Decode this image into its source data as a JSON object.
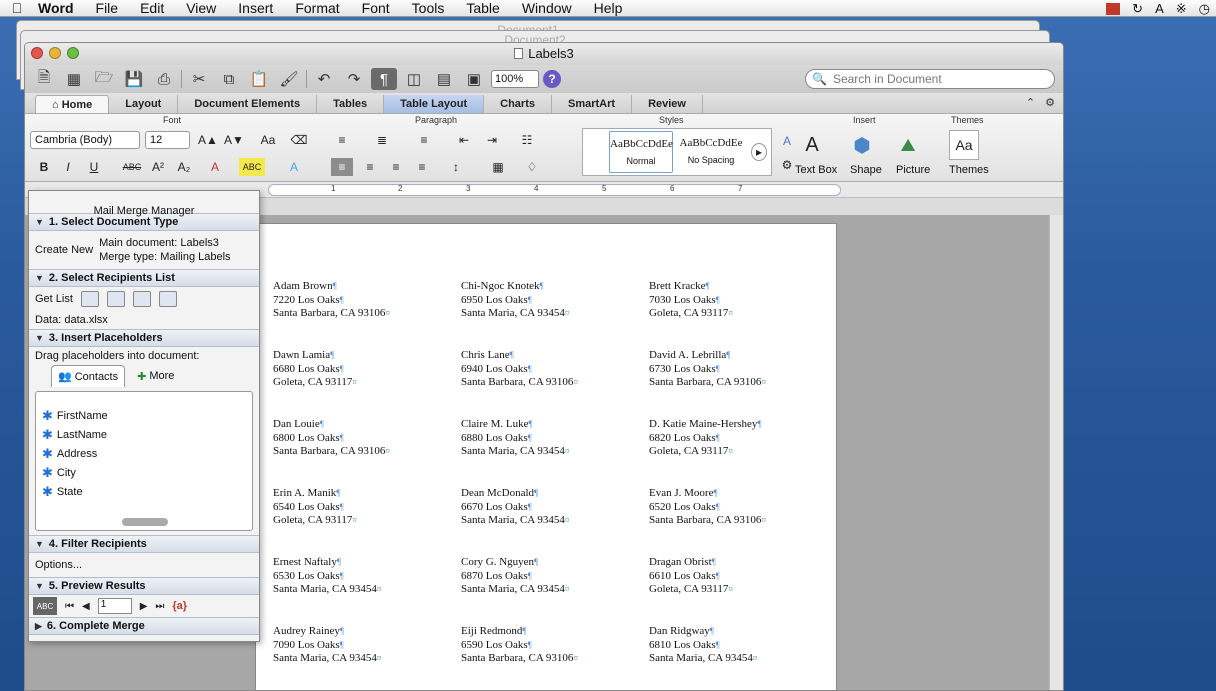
{
  "menubar": {
    "app": "Word",
    "items": [
      "File",
      "Edit",
      "View",
      "Insert",
      "Format",
      "Font",
      "Tools",
      "Table",
      "Window",
      "Help"
    ]
  },
  "bg_windows": [
    "Document1",
    "Document2"
  ],
  "window": {
    "title": "Labels3"
  },
  "toolbar": {
    "zoom": "100%",
    "search_placeholder": "Search in Document"
  },
  "ribbon": {
    "tabs": [
      "Home",
      "Layout",
      "Document Elements",
      "Tables",
      "Table Layout",
      "Charts",
      "SmartArt",
      "Review"
    ],
    "groups": {
      "font": "Font",
      "paragraph": "Paragraph",
      "styles": "Styles",
      "insert": "Insert",
      "themes": "Themes"
    },
    "font_name": "Cambria (Body)",
    "font_size": "12",
    "styles": [
      {
        "sample": "AaBbCcDdEe",
        "name": "Normal"
      },
      {
        "sample": "AaBbCcDdEe",
        "name": "No Spacing"
      }
    ],
    "insert_buttons": [
      "Text Box",
      "Shape",
      "Picture"
    ],
    "themes_button": "Themes"
  },
  "ruler": [
    "1",
    "2",
    "3",
    "4",
    "5",
    "6",
    "7"
  ],
  "mail_merge": {
    "title": "Mail Merge Manager",
    "sec1": "1. Select Document Type",
    "create_new": "Create New",
    "main_document": "Main document: Labels3",
    "merge_type": "Merge type: Mailing Labels",
    "sec2": "2. Select Recipients List",
    "get_list": "Get List",
    "data_source": "Data: data.xlsx",
    "sec3": "3. Insert Placeholders",
    "drag_hint": "Drag placeholders into document:",
    "tab_contacts": "Contacts",
    "tab_more": "More",
    "placeholders": [
      "FirstName",
      "LastName",
      "Address",
      "City",
      "State"
    ],
    "sec4": "4. Filter Recipients",
    "options": "Options...",
    "sec5": "5. Preview Results",
    "record": "1",
    "field_codes": "{a}",
    "sec6": "6. Complete Merge"
  },
  "labels": [
    [
      "Adam Brown",
      "7220 Los Oaks",
      "Santa Barbara, CA 93106"
    ],
    [
      "Chi-Ngoc Knotek",
      "6950 Los Oaks",
      "Santa Maria, CA 93454"
    ],
    [
      "Brett Kracke",
      "7030 Los Oaks",
      "Goleta, CA 93117"
    ],
    [
      "Dawn Lamia",
      "6680 Los Oaks",
      "Goleta, CA 93117"
    ],
    [
      "Chris Lane",
      "6940 Los Oaks",
      "Santa Barbara, CA 93106"
    ],
    [
      "David A. Lebrilla",
      "6730 Los Oaks",
      "Santa Barbara, CA 93106"
    ],
    [
      "Dan Louie",
      "6800 Los Oaks",
      "Santa Barbara, CA 93106"
    ],
    [
      "Claire M. Luke",
      "6880 Los Oaks",
      "Santa Maria, CA 93454"
    ],
    [
      "D. Katie Maine-Hershey",
      "6820 Los Oaks",
      "Goleta, CA 93117"
    ],
    [
      "Erin A. Manik",
      "6540 Los Oaks",
      "Goleta, CA 93117"
    ],
    [
      "Dean McDonald",
      "6670 Los Oaks",
      "Santa Maria, CA 93454"
    ],
    [
      "Evan J. Moore",
      "6520 Los Oaks",
      "Santa Barbara, CA 93106"
    ],
    [
      "Ernest Naftaly",
      "6530 Los Oaks",
      "Santa Maria, CA 93454"
    ],
    [
      "Cory G. Nguyen",
      "6870 Los Oaks",
      "Santa Maria, CA 93454"
    ],
    [
      "Dragan Obrist",
      "6610 Los Oaks",
      "Goleta, CA 93117"
    ],
    [
      "Audrey Rainey",
      "7090 Los Oaks",
      "Santa Maria, CA 93454"
    ],
    [
      "Eiji Redmond",
      "6590 Los Oaks",
      "Santa Barbara, CA 93106"
    ],
    [
      "Dan Ridgway",
      "6810 Los Oaks",
      "Santa Maria, CA 93454"
    ]
  ]
}
